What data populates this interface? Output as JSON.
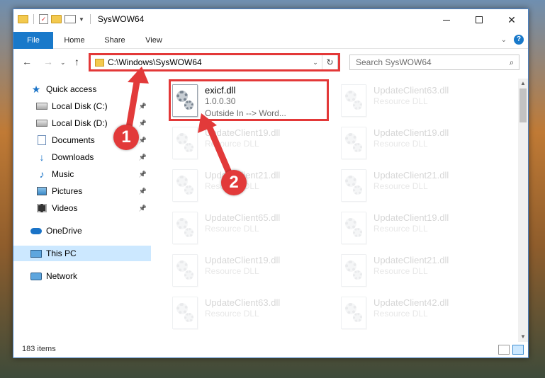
{
  "window": {
    "title": "SysWOW64"
  },
  "ribbon": {
    "tabs": [
      "File",
      "Home",
      "Share",
      "View"
    ]
  },
  "address": {
    "path": "C:\\Windows\\SysWOW64"
  },
  "search": {
    "placeholder": "Search SysWOW64"
  },
  "sidebar": {
    "items": [
      {
        "label": "Quick access",
        "icon": "star-icon"
      },
      {
        "label": "Local Disk (C:)",
        "icon": "disk-icon",
        "pinned": true
      },
      {
        "label": "Local Disk (D:)",
        "icon": "disk-icon",
        "pinned": true
      },
      {
        "label": "Documents",
        "icon": "documents-icon",
        "pinned": true
      },
      {
        "label": "Downloads",
        "icon": "download-arrow-icon",
        "pinned": true
      },
      {
        "label": "Music",
        "icon": "music-note-icon",
        "pinned": true
      },
      {
        "label": "Pictures",
        "icon": "pictures-icon",
        "pinned": true
      },
      {
        "label": "Videos",
        "icon": "video-icon",
        "pinned": true
      },
      {
        "label": "OneDrive",
        "icon": "cloud-icon"
      },
      {
        "label": "This PC",
        "icon": "computer-icon",
        "selected": true
      },
      {
        "label": "Network",
        "icon": "network-icon"
      }
    ]
  },
  "files": [
    {
      "name": "exicf.dll",
      "line2": "1.0.0.30",
      "line3": "Outside In --> Word...",
      "faded": false
    },
    {
      "name": "UpdateClient63.dll",
      "line2": "Resource DLL",
      "faded": true
    },
    {
      "name": "UpdateClient19.dll",
      "line2": "Resource DLL",
      "faded": true
    },
    {
      "name": "UpdateClient19.dll",
      "line2": "Resource DLL",
      "faded": true
    },
    {
      "name": "UpdateClient21.dll",
      "line2": "Resource DLL",
      "faded": true
    },
    {
      "name": "UpdateClient21.dll",
      "line2": "Resource DLL",
      "faded": true
    },
    {
      "name": "UpdateClient65.dll",
      "line2": "Resource DLL",
      "faded": true
    },
    {
      "name": "UpdateClient19.dll",
      "line2": "Resource DLL",
      "faded": true
    },
    {
      "name": "UpdateClient19.dll",
      "line2": "Resource DLL",
      "faded": true
    },
    {
      "name": "UpdateClient21.dll",
      "line2": "Resource DLL",
      "faded": true
    },
    {
      "name": "UpdateClient63.dll",
      "line2": "Resource DLL",
      "faded": true
    },
    {
      "name": "UpdateClient42.dll",
      "line2": "Resource DLL",
      "faded": true
    }
  ],
  "status": {
    "item_count": "183 items"
  },
  "annotations": {
    "step1": "1",
    "step2": "2",
    "color": "#e23a3a"
  }
}
